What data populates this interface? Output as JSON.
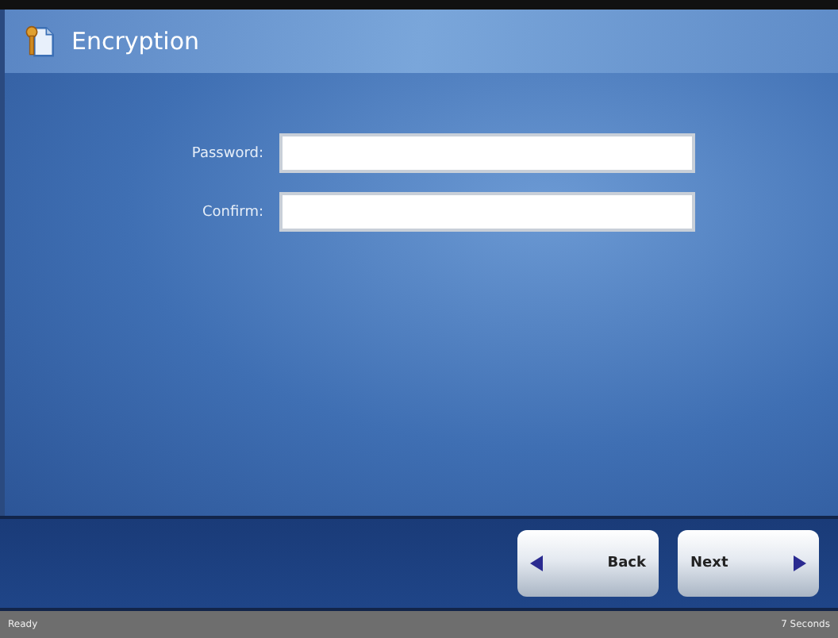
{
  "window": {
    "title": "Encryption"
  },
  "fields": [
    {
      "label": "Password:"
    },
    {
      "label": "Confirm:"
    }
  ],
  "buttons": [
    {
      "label": "Back",
      "kind": "back"
    },
    {
      "label": "Next",
      "kind": "next"
    }
  ],
  "status_bar": {
    "left": "Ready",
    "right": "7 Seconds"
  }
}
